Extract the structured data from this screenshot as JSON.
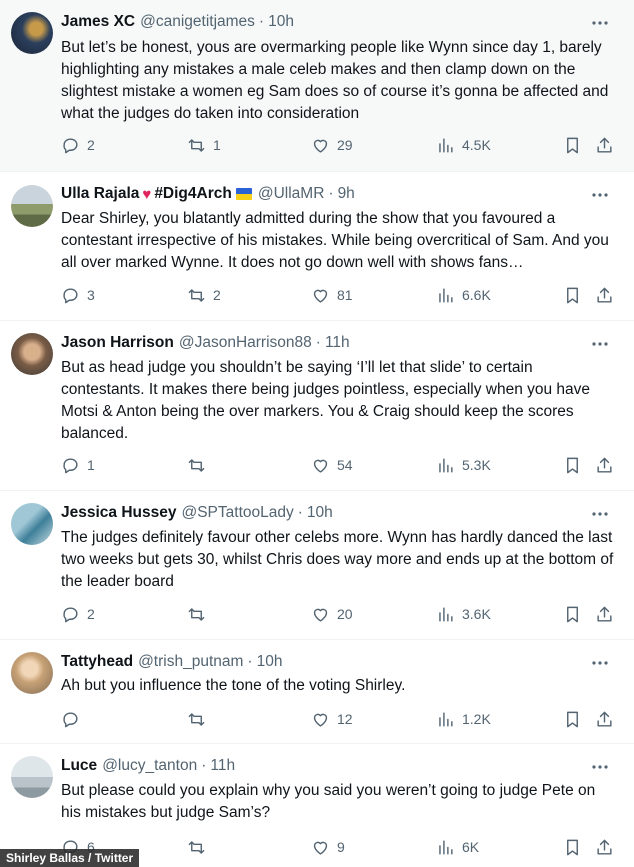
{
  "tweets": [
    {
      "name": "James XC",
      "handle": "@canigetitjames",
      "time": "10h",
      "text": "But let’s be honest, yous are overmarking people like Wynn since day 1, barely highlighting any mistakes a male celeb makes and then clamp down on the slightest mistake a women eg Sam does so of course it’s gonna be affected and what the judges do taken into consideration",
      "replies": "2",
      "retweets": "1",
      "likes": "29",
      "views": "4.5K"
    },
    {
      "name": "Ulla Rajala",
      "hashtag": "#Dig4Arch",
      "handle": "@UllaMR",
      "time": "9h",
      "text": "Dear Shirley, you blatantly admitted during the show that you favoured a contestant irrespective of his mistakes. While being overcritical of Sam. And you all over marked Wynne. It does not go down well with shows fans…",
      "replies": "3",
      "retweets": "2",
      "likes": "81",
      "views": "6.6K"
    },
    {
      "name": "Jason Harrison",
      "handle": "@JasonHarrison88",
      "time": "11h",
      "text": "But as head judge you shouldn’t be saying ‘I’ll let that slide’ to certain contestants. It makes there being judges pointless, especially when you have Motsi & Anton being the over markers. You & Craig should keep the scores balanced.",
      "replies": "1",
      "retweets": "",
      "likes": "54",
      "views": "5.3K"
    },
    {
      "name": "Jessica Hussey",
      "handle": "@SPTattooLady",
      "time": "10h",
      "text": "The judges definitely favour other celebs more. Wynn has hardly danced the last two weeks but gets 30, whilst Chris does way more and ends up at the bottom of the leader board",
      "replies": "2",
      "retweets": "",
      "likes": "20",
      "views": "3.6K"
    },
    {
      "name": "Tattyhead",
      "handle": "@trish_putnam",
      "time": "10h",
      "text": "Ah but you influence the tone of the voting Shirley.",
      "replies": "",
      "retweets": "",
      "likes": "12",
      "views": "1.2K"
    },
    {
      "name": "Luce",
      "handle": "@lucy_tanton",
      "time": "11h",
      "text": "But please could you explain why you said you weren’t going to judge Pete on his mistakes but judge Sam’s?",
      "replies": "6",
      "retweets": "",
      "likes": "9",
      "views": "6K"
    }
  ],
  "caption": "Shirley Ballas / Twitter",
  "colors": {
    "text": "#0f1419",
    "muted": "#536471",
    "divider": "#eff3f4",
    "highlight_bg": "#f7f9f9"
  }
}
